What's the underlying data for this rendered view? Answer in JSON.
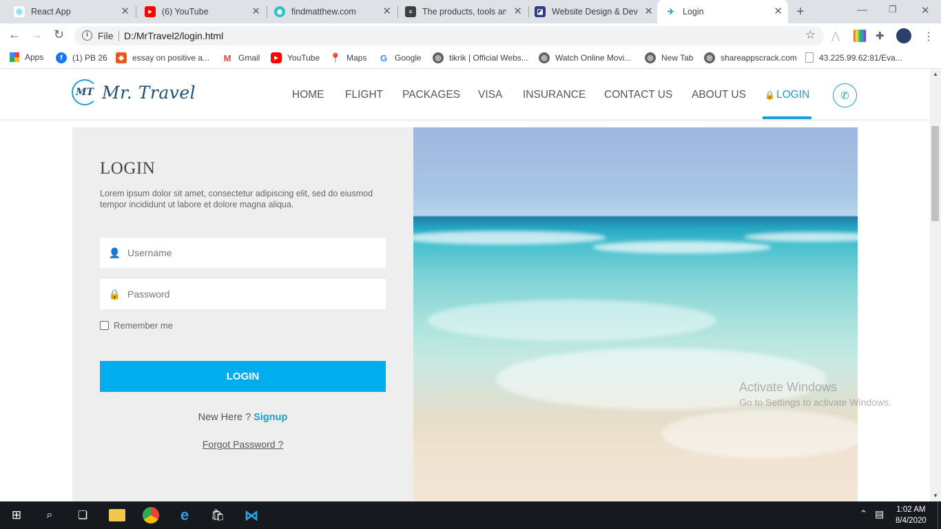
{
  "browser": {
    "tabs": [
      {
        "title": "React App",
        "icon": "react-icon",
        "active": false
      },
      {
        "title": "(6) YouTube",
        "icon": "youtube-icon",
        "active": false
      },
      {
        "title": "findmatthew.com",
        "icon": "findmatthew-icon",
        "active": false
      },
      {
        "title": "The products, tools and",
        "icon": "document-icon",
        "active": false
      },
      {
        "title": "Website Design & Deve",
        "icon": "website-design-icon",
        "active": false
      },
      {
        "title": "Login",
        "icon": "mr-travel-favicon",
        "active": true
      }
    ],
    "address": {
      "scheme_label": "File",
      "url": "D:/MrTravel2/login.html"
    },
    "bookmarks": [
      {
        "label": "Apps",
        "icon": "apps-grid-icon"
      },
      {
        "label": "(1) PB 26",
        "icon": "facebook-icon"
      },
      {
        "label": "essay on positive a...",
        "icon": "essay-icon"
      },
      {
        "label": "Gmail",
        "icon": "gmail-icon"
      },
      {
        "label": "YouTube",
        "icon": "youtube-icon"
      },
      {
        "label": "Maps",
        "icon": "maps-icon"
      },
      {
        "label": "Google",
        "icon": "google-icon"
      },
      {
        "label": "tikrik | Official Webs...",
        "icon": "globe-icon"
      },
      {
        "label": "Watch Online Movi...",
        "icon": "globe-icon"
      },
      {
        "label": "New Tab",
        "icon": "globe-icon"
      },
      {
        "label": "shareappscrack.com",
        "icon": "globe-icon"
      },
      {
        "label": "43.225.99.62:81/Eva...",
        "icon": "page-icon"
      }
    ]
  },
  "site": {
    "brand": "Mr. Travel",
    "logo_mark": "MT",
    "nav": [
      {
        "label": "HOME",
        "active": false
      },
      {
        "label": "FLIGHT",
        "active": false
      },
      {
        "label": "PACKAGES",
        "active": false
      },
      {
        "label": "VISA",
        "active": false
      },
      {
        "label": "INSURANCE",
        "active": false
      },
      {
        "label": "CONTACT US",
        "active": false
      },
      {
        "label": "ABOUT US",
        "active": false
      },
      {
        "label": "LOGIN",
        "active": true
      }
    ],
    "accent_color": "#1a9fd6",
    "button_color": "#00adef"
  },
  "login": {
    "heading": "LOGIN",
    "description": "Lorem ipsum dolor sit amet, consectetur adipiscing elit, sed do eiusmod tempor incididunt ut labore et dolore magna aliqua.",
    "username_placeholder": "Username",
    "password_placeholder": "Password",
    "remember_label": "Remember me",
    "remember_checked": false,
    "submit_label": "LOGIN",
    "new_here_text": "New Here ?",
    "signup_label": "Signup",
    "forgot_label": "Forgot Password ?"
  },
  "watermark": {
    "line1": "Activate Windows",
    "line2": "Go to Settings to activate Windows."
  },
  "taskbar": {
    "time": "1:02 AM",
    "date": "8/4/2020"
  }
}
